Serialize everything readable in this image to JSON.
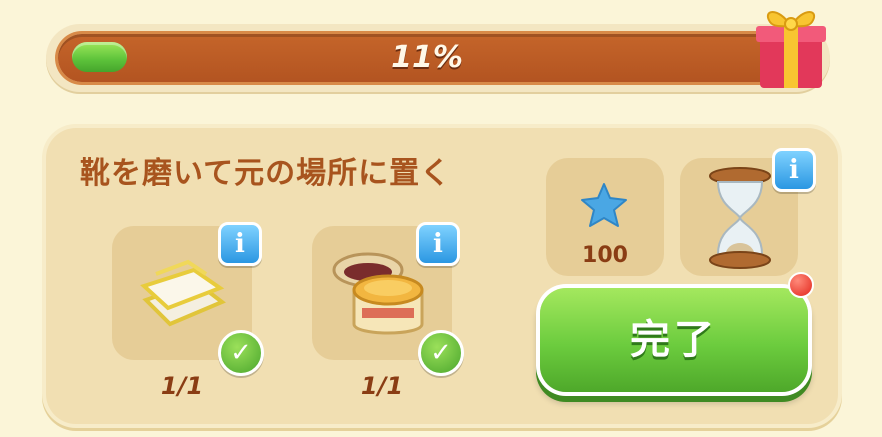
{
  "progress": {
    "percent_text": "11%",
    "value": 0.11
  },
  "task": {
    "title": "靴を磨いて元の場所に置く",
    "items": [
      {
        "icon": "cloth-icon",
        "count": "1/1",
        "completed": true
      },
      {
        "icon": "polish-jar-icon",
        "count": "1/1",
        "completed": true
      }
    ]
  },
  "rewards": {
    "star": {
      "icon": "blue-star-icon",
      "value": "100"
    },
    "time": {
      "icon": "hourglass-icon"
    }
  },
  "complete_button": {
    "label": "完了"
  },
  "info_label": "i",
  "check_label": "✓",
  "colors": {
    "accent_green": "#6ccc3e",
    "bar_brown": "#b35421",
    "title_brown": "#a8541e",
    "info_blue": "#2b97e2"
  }
}
